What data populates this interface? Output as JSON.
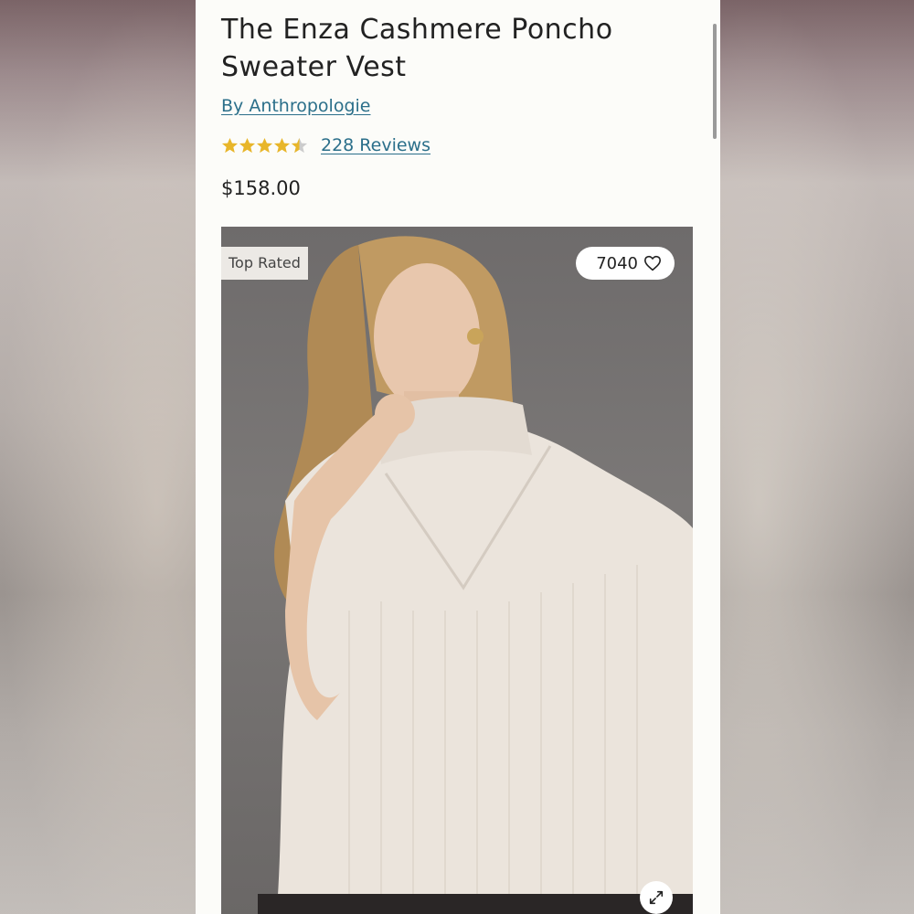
{
  "product": {
    "title": "The Enza Cashmere Poncho Sweater Vest",
    "brand_link": "By Anthropologie",
    "rating": 4.5,
    "reviews_link": "228 Reviews",
    "price": "$158.00"
  },
  "image": {
    "badge": "Top Rated",
    "likes_count": "7040"
  },
  "icons": {
    "heart": "heart-icon",
    "expand": "expand-icon",
    "star": "star-icon"
  },
  "colors": {
    "link": "#2b6f8a",
    "star": "#e8b62a",
    "star_empty": "#cccccc",
    "text": "#222222",
    "page_bg": "#fcfcf9"
  }
}
